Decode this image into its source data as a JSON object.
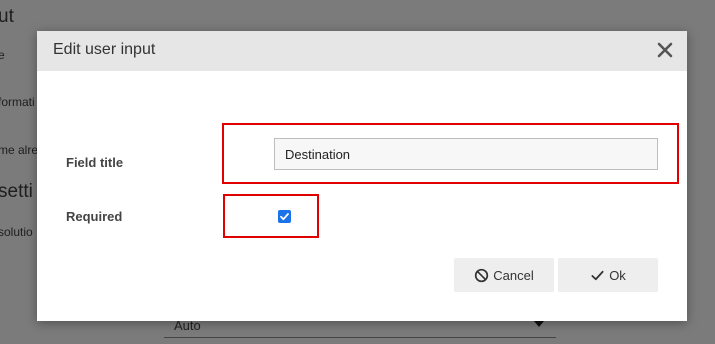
{
  "background": {
    "heading_1": "ut",
    "label_1": "e",
    "label_2": "formati",
    "label_3": "me alre",
    "heading_2": "setti",
    "label_4": "solutio",
    "select_value": "Auto"
  },
  "dialog": {
    "title": "Edit user input",
    "field_title_label": "Field title",
    "field_title_value": "Destination",
    "required_label": "Required",
    "required_checked": true,
    "cancel_label": "Cancel",
    "ok_label": "Ok"
  },
  "colors": {
    "highlight": "#e00000",
    "checkbox": "#1a73e8",
    "header_bg": "#e6e6e6"
  },
  "icons": {
    "close": "close-icon",
    "cancel": "ban-icon",
    "ok": "check-icon"
  }
}
